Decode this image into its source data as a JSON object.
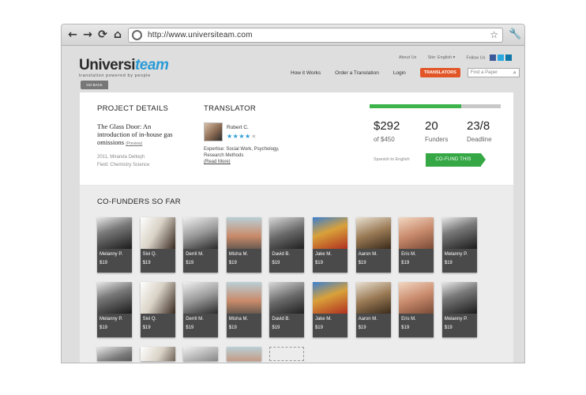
{
  "browser": {
    "url": "http://www.universiteam.com",
    "back_glyph": "←",
    "forward_glyph": "→",
    "reload_glyph": "⟳",
    "home_glyph": "⌂",
    "star_glyph": "☆",
    "wrench_glyph": "🔧"
  },
  "header": {
    "logo_main": "Universi",
    "logo_accent": "team",
    "tagline": "translation powered by people",
    "top_links": {
      "about": "About Us",
      "site_lang": "Site: English ▾",
      "follow": "Follow Us"
    },
    "social_colors": {
      "facebook": "#3b5998",
      "twitter": "#2aa9e0",
      "linkedin": "#0e76a8"
    },
    "nav": {
      "how": "How it Works",
      "order": "Order a Translation",
      "login": "Login",
      "translators": "TRANSLATORS"
    },
    "search": {
      "placeholder": "Find a Paper",
      "icon": "⌕"
    },
    "go_back": "GO BACK"
  },
  "project": {
    "section_title": "PROJECT DETAILS",
    "book_title": "The Glass Door: An introduction of in-house gas omissions",
    "preview": "(Preview)",
    "meta_line1": "2011, Miranda Delloqh",
    "meta_line2": "Field: Chemistry Science"
  },
  "translator": {
    "section_title": "TRANSLATOR",
    "name": "Robert C.",
    "stars_on": "★★★★",
    "stars_off": "★",
    "rating": 4,
    "expertise": "Expertise: Social Work, Psychology, Research Methods",
    "read_more": "(Read More)"
  },
  "funding": {
    "progress": 0.7,
    "amount": "$292",
    "goal": "of $450",
    "funders_val": "20",
    "funders_lbl": "Funders",
    "deadline_val": "23/8",
    "deadline_lbl": "Deadline",
    "language": "Spanish to English",
    "cta": "CO-FUND THIS PROJECT",
    "accent_color": "#3cb44a"
  },
  "cofunders": {
    "title": "CO-FUNDERS SO FAR",
    "row1": [
      {
        "name": "Melanny P.",
        "amount": "$19"
      },
      {
        "name": "Sivi Q.",
        "amount": "$19"
      },
      {
        "name": "Derril M.",
        "amount": "$19"
      },
      {
        "name": "Misha M.",
        "amount": "$19"
      },
      {
        "name": "David B.",
        "amount": "$19"
      },
      {
        "name": "Jake M.",
        "amount": "$19"
      },
      {
        "name": "Aaron M.",
        "amount": "$19"
      },
      {
        "name": "Eris M.",
        "amount": "$19"
      },
      {
        "name": "Melanny P.",
        "amount": "$19"
      }
    ],
    "row2": [
      {
        "name": "Melanny P.",
        "amount": "$19"
      },
      {
        "name": "Sivi Q.",
        "amount": "$19"
      },
      {
        "name": "Derril M.",
        "amount": "$19"
      },
      {
        "name": "Misha M.",
        "amount": "$19"
      },
      {
        "name": "David B.",
        "amount": "$19"
      },
      {
        "name": "Jake M.",
        "amount": "$19"
      },
      {
        "name": "Aaron M.",
        "amount": "$19"
      },
      {
        "name": "Eris M.",
        "amount": "$19"
      },
      {
        "name": "Melanny P.",
        "amount": "$19"
      }
    ]
  }
}
